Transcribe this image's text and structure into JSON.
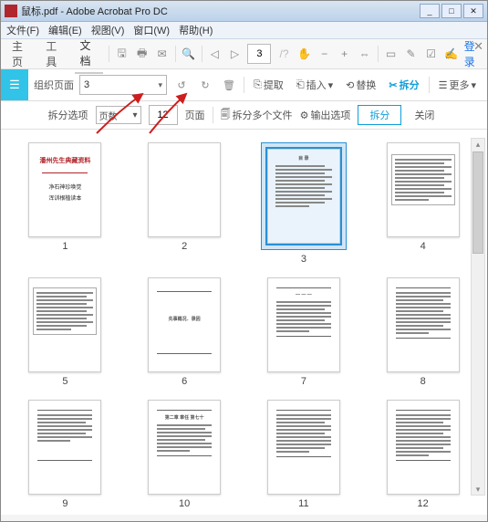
{
  "window": {
    "doc_name": "鼠标.pdf",
    "app_name": "Adobe Acrobat Pro DC",
    "title_sep": " - "
  },
  "menubar": {
    "file": "文件(F)",
    "edit": "编辑(E)",
    "view": "视图(V)",
    "window": "窗口(W)",
    "help": "帮助(H)"
  },
  "tabs_main": {
    "home": "主页",
    "tools": "工具",
    "document": "文档",
    "login": "登录",
    "current_page": "3"
  },
  "organize_bar": {
    "organize_label": "组织页面",
    "dropdown_value": "3",
    "extract": "提取",
    "insert": "插入",
    "replace": "替换",
    "split": "拆分",
    "more": "更多"
  },
  "split_bar": {
    "options_label": "拆分选项",
    "mode_dropdown": "页数",
    "number_value": "12",
    "pages_label": "页面",
    "split_multi": "拆分多个文件",
    "output_options": "输出选项",
    "split_action": "拆分",
    "close": "关闭"
  },
  "thumbs": {
    "p1": {
      "num": "1",
      "title_red": "潘州先生典藏资料",
      "line1": "净石神珍唤觉",
      "line2": "浑训根植读本"
    },
    "p2": {
      "num": "2"
    },
    "p3": {
      "num": "3",
      "heading": "目 录"
    },
    "p4": {
      "num": "4"
    },
    "p5": {
      "num": "5"
    },
    "p6": {
      "num": "6",
      "heading": "先事概况．录因"
    },
    "p7": {
      "num": "7"
    },
    "p8": {
      "num": "8"
    },
    "p9": {
      "num": "9"
    },
    "p10": {
      "num": "10",
      "heading": "第二章 章任 第七十"
    },
    "p11": {
      "num": "11"
    },
    "p12": {
      "num": "12"
    }
  },
  "colors": {
    "accent": "#0f9ed8",
    "arrow": "#cc1e1e",
    "select_bg": "#cfe6f7"
  }
}
